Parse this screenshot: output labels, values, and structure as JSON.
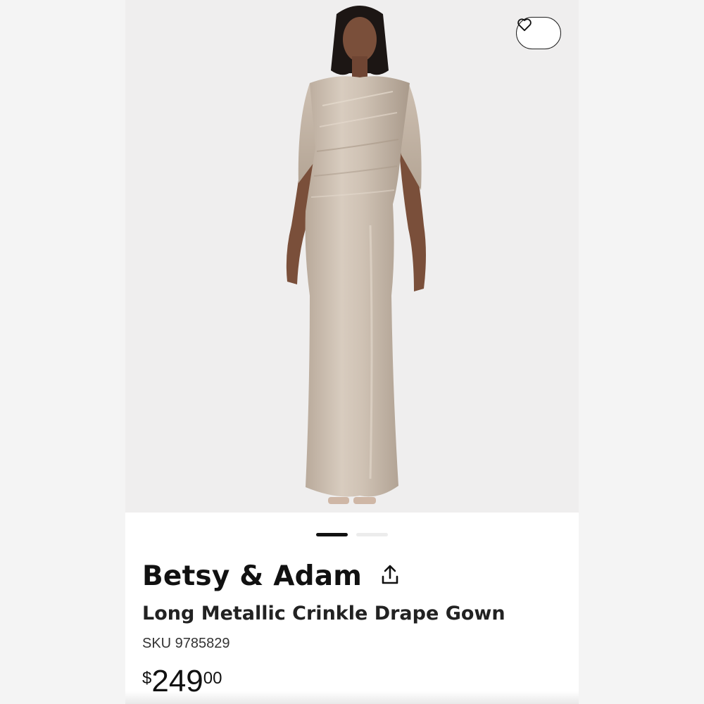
{
  "product": {
    "brand": "Betsy & Adam",
    "name": "Long Metallic Crinkle Drape Gown",
    "sku": "SKU 9785829",
    "price": {
      "currency": "$",
      "whole": "249",
      "cents": "00"
    }
  },
  "gallery": {
    "image_count": 2,
    "active_index": 0
  },
  "icons": {
    "favorite": "heart-outline-icon",
    "share": "share-upload-icon"
  },
  "colors": {
    "dress": "#cbbcad",
    "text": "#111111",
    "active_dot": "#111111",
    "inactive_dot": "#ececec"
  }
}
